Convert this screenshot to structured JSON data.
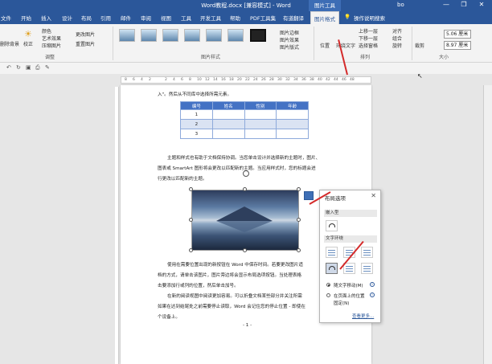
{
  "titlebar": {
    "title": "Word教程.docx [兼容模式] - Word",
    "context_tab": "图片工具",
    "user": "bo",
    "min": "—",
    "restore": "❐",
    "close": "✕"
  },
  "tabs": [
    "文件",
    "开始",
    "插入",
    "设计",
    "布局",
    "引用",
    "邮件",
    "审阅",
    "视图",
    "工具",
    "开发工具",
    "帮助",
    "PDF工具集",
    "有道翻译",
    "图片格式",
    "操作说明搜索"
  ],
  "ribbon": {
    "remove_bg": "删除背景",
    "correct": "校正",
    "color": "颜色",
    "art": "艺术效果",
    "compress": "压缩图片",
    "change": "更改图片",
    "reset": "重置图片",
    "adjust_group": "调整",
    "border": "图片边框",
    "effect": "图片效果",
    "layout": "图片版式",
    "styles_group": "图片样式",
    "position": "位置",
    "wrap": "环绕文字",
    "forward": "上移一层",
    "backward": "下移一层",
    "select_pane": "选择窗格",
    "align": "对齐",
    "group": "组合",
    "rotate": "旋转",
    "arrange_group": "排列",
    "crop": "裁剪",
    "height": "5.06 厘米",
    "width": "8.97 厘米",
    "size_group": "大小"
  },
  "ruler_ticks": [
    "8",
    "6",
    "4",
    "2",
    "2",
    "4",
    "6",
    "8",
    "10",
    "12",
    "14",
    "16",
    "18",
    "20",
    "22",
    "24",
    "26",
    "28",
    "30",
    "32",
    "34",
    "36",
    "38",
    "40",
    "42",
    "44",
    "46",
    "48"
  ],
  "document": {
    "line_top": "入\"。然后从不同库中选择所需元素。",
    "table_headers": [
      "编号",
      "姓名",
      "性别",
      "年龄"
    ],
    "table_rows": [
      "1",
      "2",
      "3"
    ],
    "para1": [
      "主题和样式也有助于文档保持协调。当您单击设计并选择新的主题时，图片、",
      "图表或 SmartArt 图形将会更改以匹配新的主题。当应用样式时，您的标题会进",
      "行更改以匹配新的主题。"
    ],
    "para2": [
      "使用在需要位置出现的新按钮在 Word 中保存时间。若要更改图片适",
      "档的方式，请单击该图片，图片旁边将会显示布局选项按钮。当处理表格",
      "击要添加行或列的位置，然后单击加号。"
    ],
    "para3": [
      "在新的阅读视图中阅读更加容易。可以折叠文档某些部分并关注所需",
      "如果在达到结尾处之前需要停止读取，Word 会记住您的停止位置 - 即使在",
      "个设备上。"
    ],
    "page_num": "- 1 -"
  },
  "panel": {
    "title": "布局选项",
    "close": "✕",
    "inline": "嵌入型",
    "wrap": "文字环绕",
    "radio1": "随文字移动(M)",
    "radio2": "在页面上的位置",
    "radio2b": "固定(N)",
    "see_more": "查看更多..."
  },
  "colors": {
    "brand": "#2b579a",
    "arrow": "#d42a2a",
    "table_header": "#4472c4"
  }
}
